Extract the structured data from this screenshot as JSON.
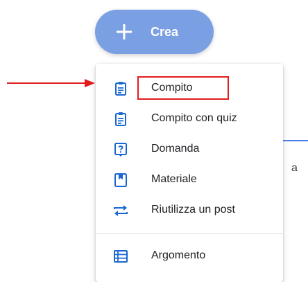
{
  "create_button": {
    "label": "Crea",
    "icon": "plus-icon"
  },
  "menu": {
    "items": [
      {
        "label": "Compito",
        "icon": "assignment-icon"
      },
      {
        "label": "Compito con quiz",
        "icon": "quiz-assignment-icon"
      },
      {
        "label": "Domanda",
        "icon": "question-icon"
      },
      {
        "label": "Materiale",
        "icon": "material-icon"
      },
      {
        "label": "Riutilizza un post",
        "icon": "repost-icon"
      },
      {
        "label": "Argomento",
        "icon": "topic-list-icon"
      }
    ]
  },
  "background": {
    "partial_text": "a"
  },
  "colors": {
    "accent": "#7b9fe3",
    "icon": "#1967d2",
    "annotation": "#e21b1b"
  }
}
